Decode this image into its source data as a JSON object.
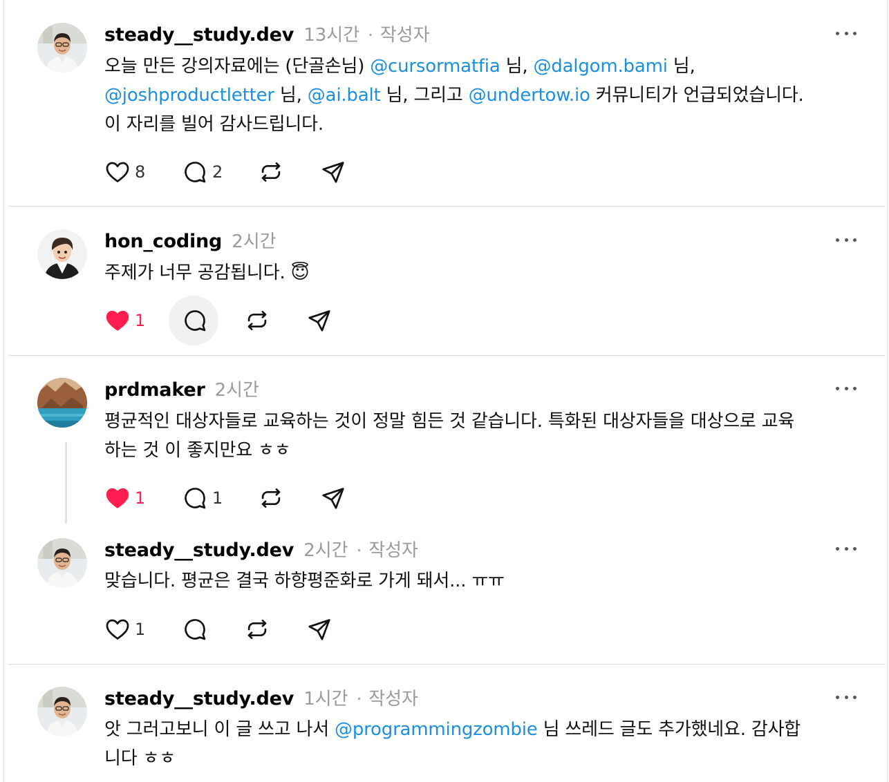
{
  "posts": [
    {
      "username": "steady__study.dev",
      "time": "13시간",
      "badge": "작성자",
      "body": {
        "l1a": "오늘 만든 강의자료에는 (단골손님) ",
        "l1b": "@cursormatfia",
        "l1c": " 님, ",
        "l1d": "@dalgom.bami",
        "l1e": " 님,",
        "l2a": "@joshproductletter",
        "l2b": " 님, ",
        "l2c": "@ai.balt",
        "l2d": " 님, 그리고 ",
        "l2e": "@undertow.io",
        "l2f": " 커뮤니티가 언급되었습니다.",
        "l3": "이 자리를 빌어 감사드립니다."
      },
      "likes": "8",
      "replies": "2"
    },
    {
      "username": "hon_coding",
      "time": "2시간",
      "body": "주제가 너무 공감됩니다. 😇",
      "likes": "1"
    },
    {
      "username": "prdmaker",
      "time": "2시간",
      "body": {
        "l1": "평균적인 대상자들로 교육하는 것이 정말 힘든 것 같습니다. 특화된 대상자들을 대상으로 교육",
        "l2": "하는 것 이 좋지만요 ㅎㅎ"
      },
      "likes": "1",
      "replies": "1"
    },
    {
      "username": "steady__study.dev",
      "time": "2시간",
      "badge": "작성자",
      "body": "맞습니다. 평균은 결국 하향평준화로 가게 돼서... ㅠㅠ",
      "likes": "1"
    },
    {
      "username": "steady__study.dev",
      "time": "1시간",
      "badge": "작성자",
      "body": {
        "l1a": "앗 그러고보니 이 글 쓰고 나서 ",
        "l1b": "@programmingzombie",
        "l1c": " 님 쓰레드 글도 추가했네요. 감사합",
        "l2": "니다 ㅎㅎ"
      }
    }
  ],
  "dot": "·",
  "colors": {
    "mention": "#1a8fe3",
    "liked": "#ff1e4d"
  },
  "icons": [
    "heart-icon",
    "heart-filled-icon",
    "comment-icon",
    "repost-icon",
    "share-icon",
    "more-icon"
  ]
}
